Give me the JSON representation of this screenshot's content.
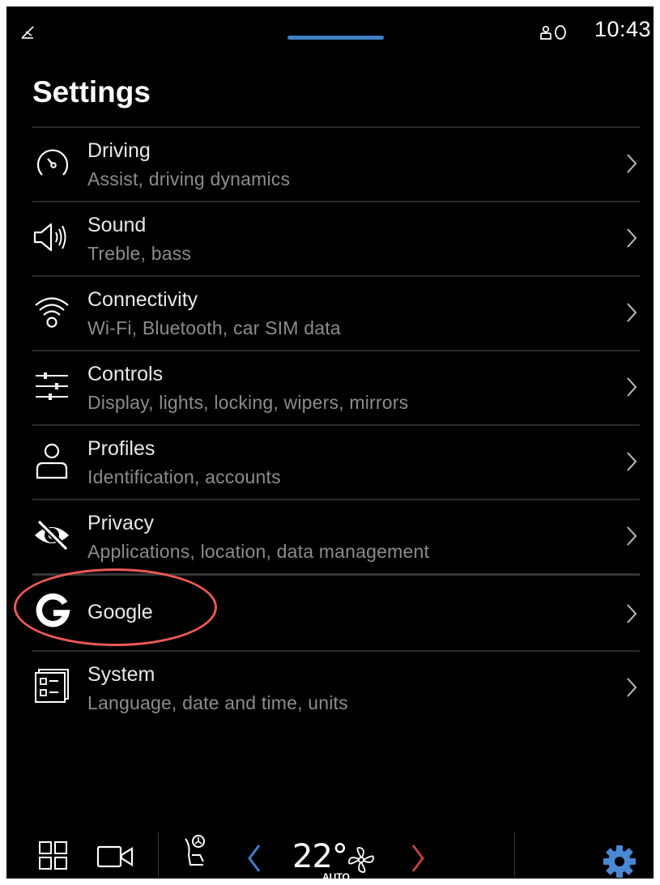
{
  "status": {
    "clock": "10:43",
    "left_icon": "no-signal-icon",
    "profile_icon": "profile-indicator-icon"
  },
  "title": "Settings",
  "menu": [
    {
      "title": "Driving",
      "subtitle": "Assist, driving dynamics",
      "icon": "speedometer-icon"
    },
    {
      "title": "Sound",
      "subtitle": "Treble, bass",
      "icon": "speaker-icon"
    },
    {
      "title": "Connectivity",
      "subtitle": "Wi-Fi, Bluetooth, car SIM data",
      "icon": "wifi-icon"
    },
    {
      "title": "Controls",
      "subtitle": "Display, lights, locking, wipers, mirrors",
      "icon": "sliders-icon"
    },
    {
      "title": "Profiles",
      "subtitle": "Identification, accounts",
      "icon": "person-icon"
    },
    {
      "title": "Privacy",
      "subtitle": "Applications, location, data management",
      "icon": "eye-slash-icon"
    },
    {
      "title": "Google",
      "subtitle": "",
      "icon": "google-icon"
    },
    {
      "title": "System",
      "subtitle": "Language, date and time, units",
      "icon": "system-icon"
    }
  ],
  "highlight": {
    "target": "Google",
    "color": "#ec5a55"
  },
  "climate": {
    "temperature": "22°",
    "mode": "AUTO"
  },
  "colors": {
    "accent": "#3f7fc8",
    "temp_decrease": "#3f7fc8",
    "temp_increase": "#c4403d",
    "settings_gear": "#4a88d4"
  }
}
